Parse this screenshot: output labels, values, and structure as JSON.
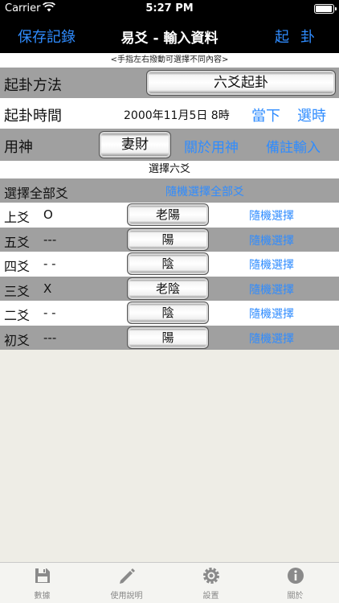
{
  "status": {
    "carrier": "Carrier",
    "time": "5:27 PM",
    "battery_level_percent": 85
  },
  "nav": {
    "left_button": "保存記錄",
    "title": "易爻 - 輸入資料",
    "right_button": "起卦"
  },
  "hint": "<手指左右撥動可選擇不同內容>",
  "method": {
    "label": "起卦方法",
    "value": "六爻起卦"
  },
  "time_row": {
    "label": "起卦時間",
    "value": "2000年11月5日 8時",
    "now_button": "當下",
    "choose_button": "選時"
  },
  "yongshen": {
    "label": "用神",
    "value": "妻財",
    "about_button": "關於用神",
    "note_button": "備註輸入"
  },
  "section_title": "選擇六爻",
  "select_all": {
    "label": "選擇全部爻",
    "random_all": "隨機選擇全部爻"
  },
  "yao_rows": [
    {
      "name": "上爻",
      "symbol": "O",
      "value": "老陽",
      "random": "隨機選擇"
    },
    {
      "name": "五爻",
      "symbol": "---",
      "value": "陽",
      "random": "隨機選擇"
    },
    {
      "name": "四爻",
      "symbol": "- -",
      "value": "陰",
      "random": "隨機選擇"
    },
    {
      "name": "三爻",
      "symbol": "X",
      "value": "老陰",
      "random": "隨機選擇"
    },
    {
      "name": "二爻",
      "symbol": "- -",
      "value": "陰",
      "random": "隨機選擇"
    },
    {
      "name": "初爻",
      "symbol": "---",
      "value": "陽",
      "random": "隨機選擇"
    }
  ],
  "tabs": [
    {
      "label": "數據",
      "icon": "floppy-disk-icon"
    },
    {
      "label": "使用說明",
      "icon": "pencil-icon"
    },
    {
      "label": "設置",
      "icon": "gear-icon"
    },
    {
      "label": "關於",
      "icon": "info-icon"
    }
  ],
  "colors": {
    "accent": "#2f8cff",
    "nav_bg": "#000000",
    "grey_row": "#a0a0a0"
  }
}
